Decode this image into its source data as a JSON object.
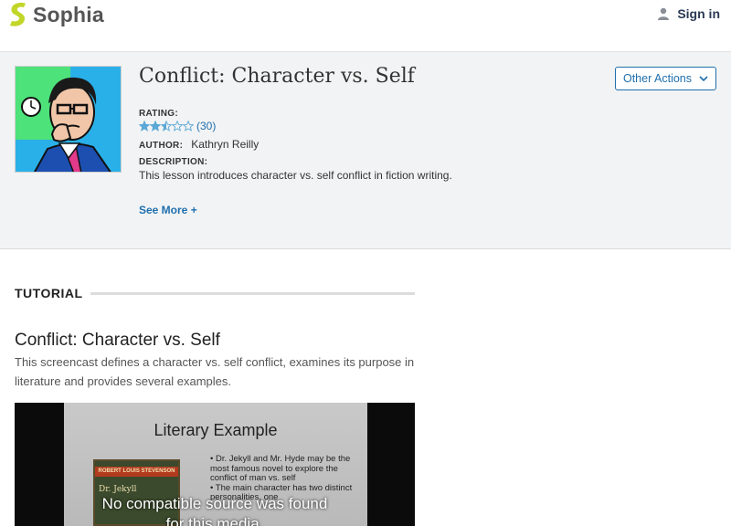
{
  "header": {
    "brand": "Sophia",
    "sign_in": "Sign in",
    "user_icon": "person-icon",
    "brand_colors": {
      "mark": "#c2d629",
      "text": "#555555"
    }
  },
  "lesson": {
    "title": "Conflict: Character vs. Self",
    "other_actions": "Other Actions",
    "rating_label": "RATING:",
    "rating_value": 2.5,
    "rating_max": 5,
    "rating_count": "(30)",
    "author_label": "AUTHOR:",
    "author": "Kathryn Reilly",
    "description_label": "DESCRIPTION:",
    "description": "This lesson introduces character vs. self conflict in fiction writing.",
    "see_more": "See More +"
  },
  "tutorial": {
    "section_label": "TUTORIAL",
    "title": "Conflict: Character vs. Self",
    "summary": "This screencast defines a character vs. self conflict, examines its purpose in literature and provides several examples."
  },
  "video": {
    "slide_title": "Literary Example",
    "book_author": "ROBERT LOUIS STEVENSON",
    "book_title": "Dr. Jekyll",
    "bullet_1": "• Dr. Jekyll and Mr. Hyde may be the most famous novel to explore the conflict of man vs. self",
    "bullet_2": "• The main character has two distinct personalities, one",
    "error_line_1": "No compatible source was found",
    "error_line_2": "for this media."
  },
  "colors": {
    "accent": "#1f6fae",
    "panel_bg": "#f2f3f4",
    "star": "#5aa8d6"
  }
}
